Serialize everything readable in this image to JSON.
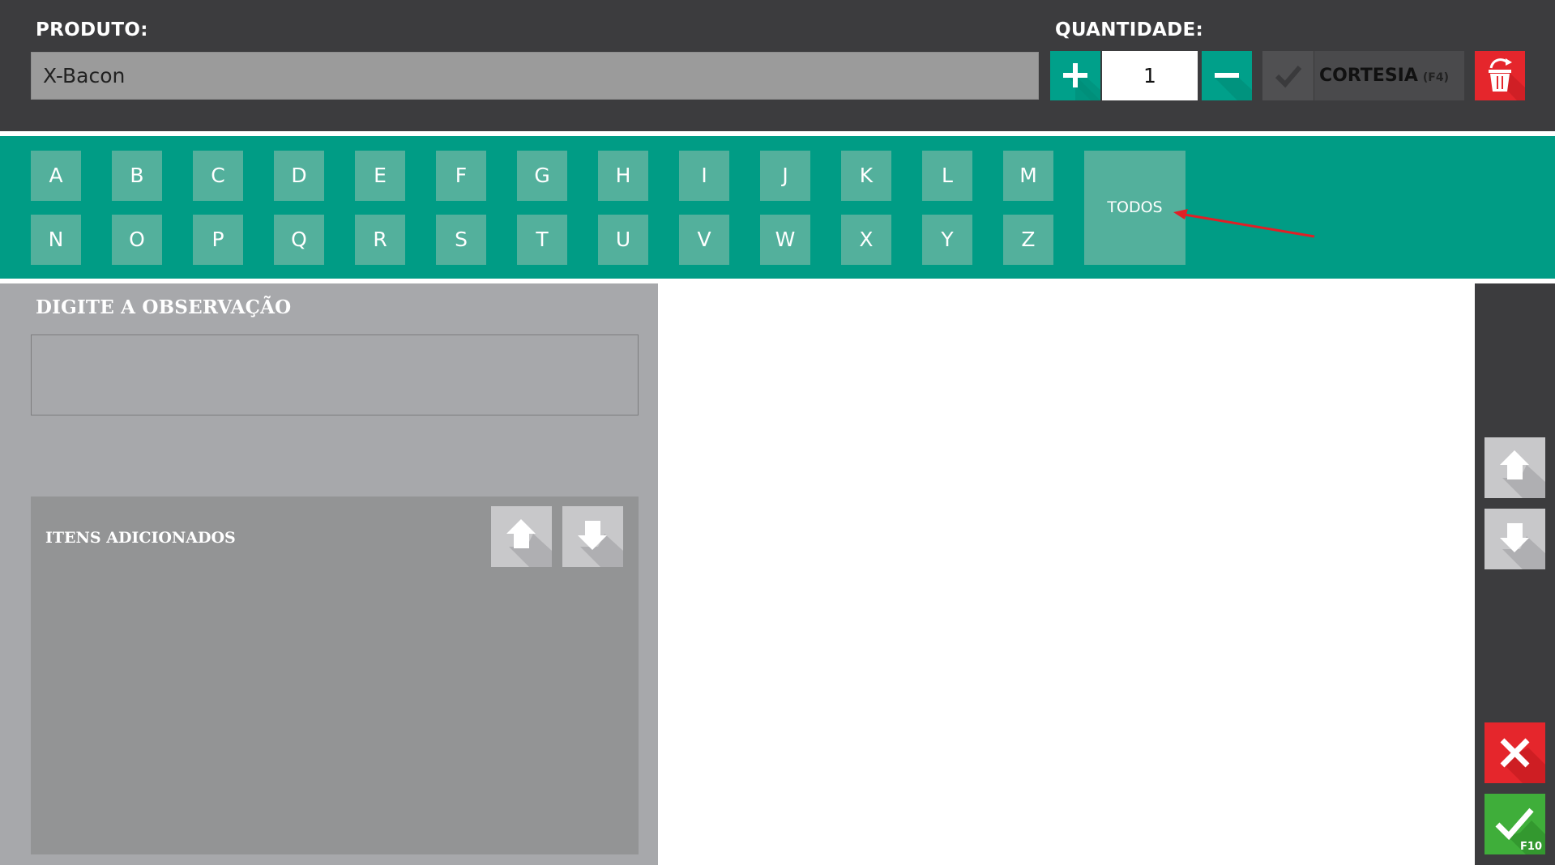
{
  "header": {
    "produto_label": "PRODUTO:",
    "produto_value": "X-Bacon",
    "quantidade_label": "QUANTIDADE:",
    "quantidade_value": "1",
    "cortesia_label": "CORTESIA",
    "cortesia_key": "(F4)"
  },
  "alphabet": {
    "row1": [
      "A",
      "B",
      "C",
      "D",
      "E",
      "F",
      "G",
      "H",
      "I",
      "J",
      "K",
      "L",
      "M"
    ],
    "row2": [
      "N",
      "O",
      "P",
      "Q",
      "R",
      "S",
      "T",
      "U",
      "V",
      "W",
      "X",
      "Y",
      "Z"
    ],
    "todos_label": "TODOS"
  },
  "observation": {
    "title": "DIGITE A OBSERVAÇÃO",
    "value": ""
  },
  "items": {
    "title": "ITENS ADICIONADOS"
  },
  "actions": {
    "confirm_key": "F10"
  },
  "colors": {
    "header_bg": "#3c3c3e",
    "accent_teal": "#009c85",
    "key_teal": "#53b09c",
    "danger_red": "#e5262c",
    "confirm_green": "#3fae3a",
    "annotation_red": "#e01f26"
  },
  "icons": {
    "plus": "plus-icon",
    "minus": "minus-icon",
    "check": "check-icon",
    "trash": "trash-icon",
    "arrow_up": "arrow-up-icon",
    "arrow_down": "arrow-down-icon",
    "close": "close-icon"
  }
}
